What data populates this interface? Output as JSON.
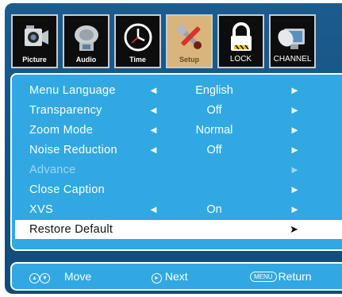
{
  "tabs": [
    {
      "label": "Picture",
      "icon": "camcorder-icon"
    },
    {
      "label": "Audio",
      "icon": "speaker-icon"
    },
    {
      "label": "Time",
      "icon": "clock-icon"
    },
    {
      "label": "Setup",
      "icon": "wrench-tools-icon",
      "active": true
    },
    {
      "label": "LOCK",
      "icon": "padlock-icon"
    },
    {
      "label": "CHANNEL",
      "icon": "satellite-dish-icon"
    }
  ],
  "menu": {
    "items": [
      {
        "label": "Menu Language",
        "value": "English"
      },
      {
        "label": "Transparency",
        "value": "Off"
      },
      {
        "label": "Zoom Mode",
        "value": "Normal"
      },
      {
        "label": "Noise Reduction",
        "value": "Off"
      },
      {
        "label": "Advance",
        "value": ""
      },
      {
        "label": "Close Caption",
        "value": ""
      },
      {
        "label": "XVS",
        "value": "On"
      },
      {
        "label": "Restore Default",
        "value": ""
      }
    ],
    "arrow_left": "◄",
    "arrow_right": "►",
    "selected_arrow": "➤"
  },
  "footer": {
    "move_label": "Move",
    "next_label": "Next",
    "menu_key": "MENU",
    "return_label": "Return"
  },
  "colors": {
    "frame": "#1b5c8e",
    "menu_bg": "#31a8e2",
    "active_tab": "#d8b57c"
  }
}
